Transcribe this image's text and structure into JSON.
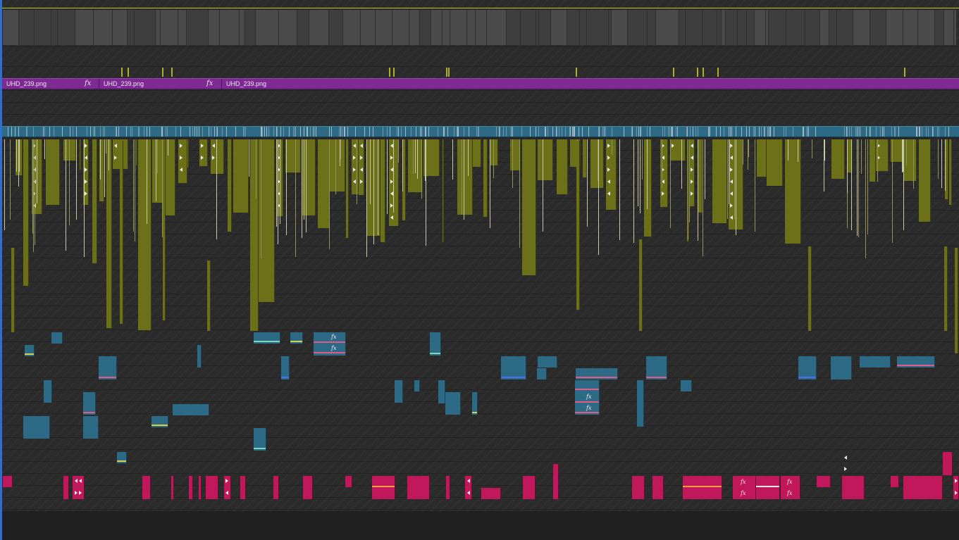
{
  "timeline": {
    "purple_track_clips": [
      {
        "label": "UHD_239.png",
        "fx": "fx"
      },
      {
        "label": "UHD_239.png",
        "fx": "fx"
      },
      {
        "label": "UHD_239.png",
        "fx": ""
      }
    ],
    "fx_badge": "fx"
  },
  "colors": {
    "video_clip": "#6b7019",
    "audio_clip_blue": "#2c6a86",
    "graphic_clip_purple": "#7d2a93",
    "magenta_clip": "#c0185a",
    "playhead_line": "#2d6fd6",
    "in_out_indicator": "#c9c934"
  },
  "icons": {
    "transition_marker": "bowtie-transition-icon",
    "effect_badge": "fx-icon"
  }
}
